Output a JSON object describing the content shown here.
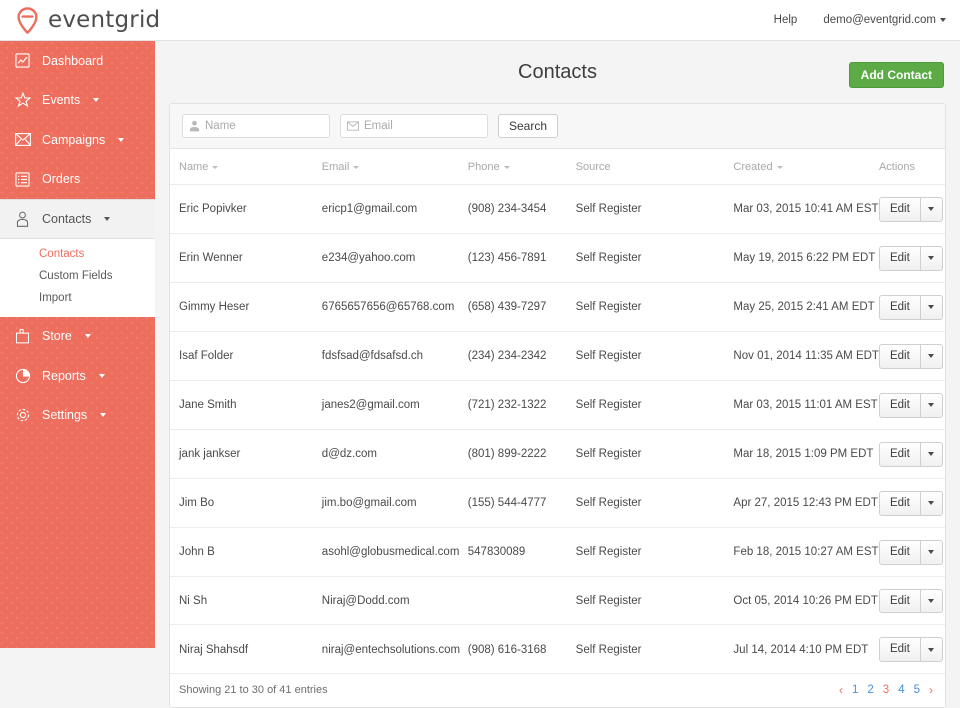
{
  "brand": {
    "name": "eventgrid",
    "logo_icon": "location-pin-icon",
    "accent": "#ee6e5e"
  },
  "topbar": {
    "help_label": "Help",
    "account_label": "demo@eventgrid.com"
  },
  "sidebar": {
    "items": [
      {
        "label": "Dashboard",
        "icon": "chart-icon",
        "caret": false
      },
      {
        "label": "Events",
        "icon": "star-icon",
        "caret": true
      },
      {
        "label": "Campaigns",
        "icon": "envelope-icon",
        "caret": true
      },
      {
        "label": "Orders",
        "icon": "list-icon",
        "caret": false
      },
      {
        "label": "Contacts",
        "icon": "user-icon",
        "caret": true,
        "open": true
      },
      {
        "label": "Store",
        "icon": "shopping-bag-icon",
        "caret": true
      },
      {
        "label": "Reports",
        "icon": "pie-chart-icon",
        "caret": true
      },
      {
        "label": "Settings",
        "icon": "gear-icon",
        "caret": true
      }
    ],
    "contacts_submenu": [
      {
        "label": "Contacts",
        "active": true
      },
      {
        "label": "Custom Fields",
        "active": false
      },
      {
        "label": "Import",
        "active": false
      }
    ]
  },
  "page": {
    "title": "Contacts",
    "add_button_label": "Add Contact",
    "add_button_color": "#5cab47"
  },
  "search": {
    "name_placeholder": "Name",
    "name_value": "",
    "name_icon": "user-icon",
    "email_placeholder": "Email",
    "email_value": "",
    "email_icon": "envelope-icon",
    "search_button_label": "Search"
  },
  "table": {
    "columns": [
      {
        "label": "Name",
        "sortable": true
      },
      {
        "label": "Email",
        "sortable": true
      },
      {
        "label": "Phone",
        "sortable": true
      },
      {
        "label": "Source",
        "sortable": false
      },
      {
        "label": "Created",
        "sortable": true
      },
      {
        "label": "Actions",
        "sortable": false
      }
    ],
    "rows": [
      {
        "name": "Eric Popivker",
        "email": "ericp1@gmail.com",
        "phone": "(908) 234-3454",
        "source": "Self Register",
        "created": "Mar 03, 2015 10:41 AM EST",
        "action": "Edit"
      },
      {
        "name": "Erin Wenner",
        "email": "e234@yahoo.com",
        "phone": "(123) 456-7891",
        "source": "Self Register",
        "created": "May 19, 2015 6:22 PM EDT",
        "action": "Edit"
      },
      {
        "name": "Gimmy Heser",
        "email": "6765657656@65768.com",
        "phone": "(658) 439-7297",
        "source": "Self Register",
        "created": "May 25, 2015 2:41 AM EDT",
        "action": "Edit"
      },
      {
        "name": "Isaf Folder",
        "email": "fdsfsad@fdsafsd.ch",
        "phone": "(234) 234-2342",
        "source": "Self Register",
        "created": "Nov 01, 2014 11:35 AM EDT",
        "action": "Edit"
      },
      {
        "name": "Jane Smith",
        "email": "janes2@gmail.com",
        "phone": "(721) 232-1322",
        "source": "Self Register",
        "created": "Mar 03, 2015 11:01 AM EST",
        "action": "Edit"
      },
      {
        "name": "jank jankser",
        "email": "d@dz.com",
        "phone": "(801) 899-2222",
        "source": "Self Register",
        "created": "Mar 18, 2015 1:09 PM EDT",
        "action": "Edit"
      },
      {
        "name": "Jim Bo",
        "email": "jim.bo@gmail.com",
        "phone": "(155) 544-4777",
        "source": "Self Register",
        "created": "Apr 27, 2015 12:43 PM EDT",
        "action": "Edit"
      },
      {
        "name": "John B",
        "email": "asohl@globusmedical.com",
        "phone": "547830089",
        "source": "Self Register",
        "created": "Feb 18, 2015 10:27 AM EST",
        "action": "Edit"
      },
      {
        "name": "Ni Sh",
        "email": "Niraj@Dodd.com",
        "phone": "",
        "source": "Self Register",
        "created": "Oct 05, 2014 10:26 PM EDT",
        "action": "Edit"
      },
      {
        "name": "Niraj Shahsdf",
        "email": "niraj@entechsolutions.com",
        "phone": "(908) 616-3168",
        "source": "Self Register",
        "created": "Jul 14, 2014 4:10 PM EDT",
        "action": "Edit"
      }
    ]
  },
  "footer": {
    "summary": "Showing 21 to 30 of 41 entries",
    "pager": {
      "prev": "‹",
      "next": "›",
      "pages": [
        "1",
        "2",
        "3",
        "4",
        "5"
      ],
      "current": "3",
      "link_color": "#4a8fd6",
      "active_color": "#ee6e5e"
    }
  }
}
